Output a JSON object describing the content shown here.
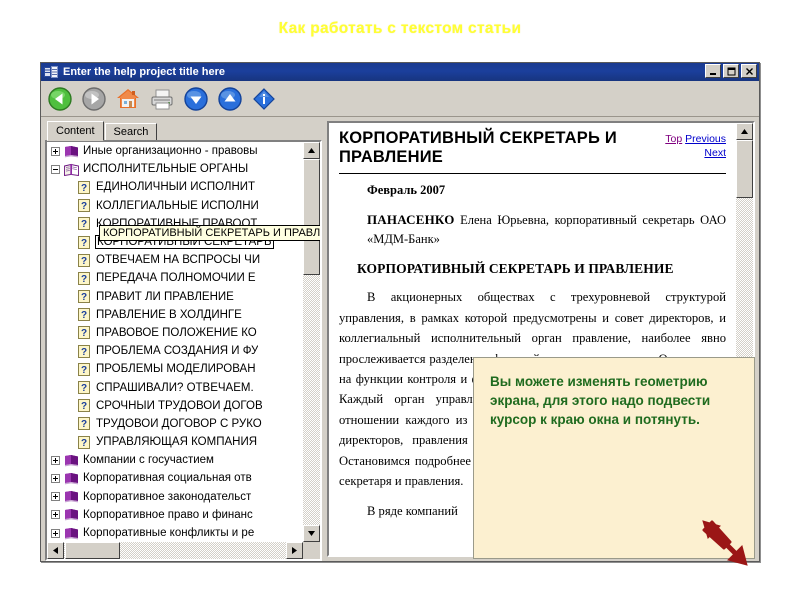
{
  "slide": {
    "title": "Как работать с текстом статьи",
    "title_color": "#ffff33"
  },
  "help_window": {
    "titlebar": {
      "title": "Enter the help project title here",
      "icon": "help-book-icon",
      "bg_color": "#1a3a8f",
      "buttons": [
        {
          "name": "minimize-button",
          "glyph": "_"
        },
        {
          "name": "maximize-button",
          "glyph": "□"
        },
        {
          "name": "close-button",
          "glyph": "✕"
        }
      ]
    },
    "toolbar": {
      "buttons": [
        {
          "name": "back-button",
          "icon": "back-arrow-icon",
          "color": "#3aa832",
          "enabled": true
        },
        {
          "name": "forward-button",
          "icon": "forward-arrow-icon",
          "color": "#9a9a9a",
          "enabled": false
        },
        {
          "name": "home-button",
          "icon": "home-icon",
          "color": "#e06a2a",
          "enabled": true
        },
        {
          "name": "print-button",
          "icon": "printer-icon",
          "color": "#cfcfcf",
          "enabled": true
        },
        {
          "name": "next-topic-button",
          "icon": "down-arrow-icon",
          "color": "#1d5fd0",
          "enabled": true
        },
        {
          "name": "prev-topic-button",
          "icon": "up-arrow-icon",
          "color": "#1d5fd0",
          "enabled": true
        },
        {
          "name": "options-button",
          "icon": "info-diamond-icon",
          "color": "#1d5fd0",
          "enabled": true
        }
      ]
    },
    "nav": {
      "tabs": [
        {
          "label": "Content",
          "active": true
        },
        {
          "label": "Search",
          "active": false
        }
      ],
      "tree": [
        {
          "label": "Иные организационно - правовы",
          "icon": "closed-book-icon",
          "expander": "plus",
          "indent": 0
        },
        {
          "label": "ИСПОЛНИТЕЛЬНЫЕ ОРГАНЫ",
          "icon": "open-book-icon",
          "expander": "minus",
          "indent": 0
        },
        {
          "label": "ЕДИНОЛИЧНЫЙ ИСПОЛНИТ",
          "icon": "help-page-icon",
          "expander": "none",
          "indent": 1
        },
        {
          "label": "КОЛЛЕГИАЛЬНЫЕ ИСПОЛНИ",
          "icon": "help-page-icon",
          "expander": "none",
          "indent": 1
        },
        {
          "label": "КОРПОРАТИВНЫЕ ПРАВООТ",
          "icon": "help-page-icon",
          "expander": "none",
          "indent": 1
        },
        {
          "label": "КОРПОРАТИВНЫЙ СЕКРЕТАРЬ",
          "icon": "help-page-icon",
          "expander": "none",
          "indent": 1,
          "selected": true
        },
        {
          "label": "ОТВЕЧАЕМ НА ВСПРОСЫ ЧИ",
          "icon": "help-page-icon",
          "expander": "none",
          "indent": 1
        },
        {
          "label": "ПЕРЕДАЧА ПОЛНОМОЧИЙ Е",
          "icon": "help-page-icon",
          "expander": "none",
          "indent": 1
        },
        {
          "label": "ПРАВИТ ЛИ ПРАВЛЕНИЕ",
          "icon": "help-page-icon",
          "expander": "none",
          "indent": 1
        },
        {
          "label": "ПРАВЛЕНИЕ В ХОЛДИНГЕ",
          "icon": "help-page-icon",
          "expander": "none",
          "indent": 1
        },
        {
          "label": "ПРАВОВОЕ ПОЛОЖЕНИЕ КО",
          "icon": "help-page-icon",
          "expander": "none",
          "indent": 1
        },
        {
          "label": "ПРОБЛЕМА СОЗДАНИЯ И ФУ",
          "icon": "help-page-icon",
          "expander": "none",
          "indent": 1
        },
        {
          "label": "ПРОБЛЕМЫ МОДЕЛИРОВАН",
          "icon": "help-page-icon",
          "expander": "none",
          "indent": 1
        },
        {
          "label": "СПРАШИВАЛИ? ОТВЕЧАЕМ.",
          "icon": "help-page-icon",
          "expander": "none",
          "indent": 1
        },
        {
          "label": "СРОЧНЫЙ ТРУДОВОЙ ДОГОВ",
          "icon": "help-page-icon",
          "expander": "none",
          "indent": 1
        },
        {
          "label": "ТРУДОВОЙ ДОГОВОР С РУКО",
          "icon": "help-page-icon",
          "expander": "none",
          "indent": 1
        },
        {
          "label": "УПРАВЛЯЮЩАЯ КОМПАНИЯ",
          "icon": "help-page-icon",
          "expander": "none",
          "indent": 1
        },
        {
          "label": "Компании с госучастием",
          "icon": "closed-book-icon",
          "expander": "plus",
          "indent": 0
        },
        {
          "label": "Корпоративная социальная отв",
          "icon": "closed-book-icon",
          "expander": "plus",
          "indent": 0
        },
        {
          "label": "Корпоративное законодательст",
          "icon": "closed-book-icon",
          "expander": "plus",
          "indent": 0
        },
        {
          "label": "Корпоративное право и финанс",
          "icon": "closed-book-icon",
          "expander": "plus",
          "indent": 0
        },
        {
          "label": "Корпоративные конфликты и ре",
          "icon": "closed-book-icon",
          "expander": "plus",
          "indent": 0
        }
      ],
      "tooltip": "КОРПОРАТИВНЫЙ СЕКРЕТАРЬ И ПРАВЛЕНИЕ"
    },
    "document": {
      "title": "КОРПОРАТИВНЫЙ СЕКРЕТАРЬ И ПРАВЛЕНИЕ",
      "links": [
        {
          "label": "Top",
          "state": "visited"
        },
        {
          "label": "Previous",
          "state": "normal"
        },
        {
          "label": "Next",
          "state": "normal"
        }
      ],
      "date": "Февраль 2007",
      "author_name": "ПАНАСЕНКО",
      "author_rest": "Елена Юрьевна, корпоративный секретарь ОАО «МДМ-Банк»",
      "heading": "КОРПОРАТИВНЫЙ СЕКРЕТАРЬ И ПРАВЛЕНИЕ",
      "paragraph1": "В акционерных обществах с трехуровневой структурой управления, в рамках которой предусмотрены и совет директоров, и коллегиальный исполнительный орган правление, наиболее явно прослеживается разделение функций органов управления. Они делятся на функции контроля и функции руководства текущей деятельностью. Каждый орган управления призван выполнять свою задачу. В отношении каждого из них — общего собрания акционеров, совета директоров, правления и единоличного корпоративного секретаря. Остановимся подробнее на характере взаимодействия корпоративного секретаря и правления.",
      "paragraph2": "В ряде компаний"
    }
  },
  "callout": {
    "text": "Вы можете изменять геометрию экрана, для этого надо подвести курсор к краю окна и потянуть.",
    "text_color": "#1f6b1f",
    "bg_color": "#fcf0d0"
  },
  "annotation": {
    "resize_arrow": "double-headed-resize-arrow-icon",
    "arrow_color": "#9b1616"
  }
}
